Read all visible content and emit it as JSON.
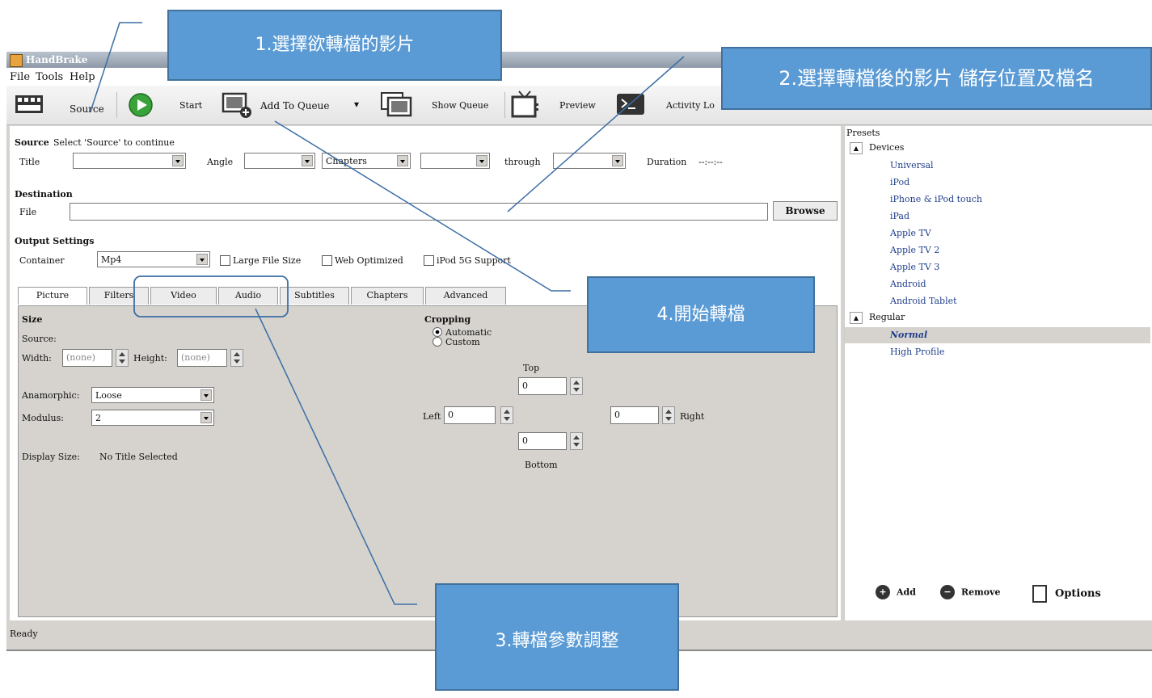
{
  "window": {
    "title": "HandBrake"
  },
  "menu": [
    "File",
    "Tools",
    "Help"
  ],
  "toolbar": {
    "source": "Source",
    "start": "Start",
    "add_to_queue": "Add To Queue",
    "show_queue": "Show Queue",
    "preview": "Preview",
    "activity_log": "Activity Lo"
  },
  "source": {
    "heading": "Source",
    "hint": "Select 'Source' to continue",
    "title_label": "Title",
    "angle_label": "Angle",
    "chapters_value": "Chapters",
    "through_label": "through",
    "duration_label": "Duration",
    "duration_value": "--:--:--"
  },
  "destination": {
    "heading": "Destination",
    "file_label": "File",
    "file_value": "",
    "browse": "Browse"
  },
  "output": {
    "heading": "Output Settings",
    "container_label": "Container",
    "container_value": "Mp4",
    "large_file": "Large File Size",
    "web_optimized": "Web Optimized",
    "ipod_support": "iPod 5G Support"
  },
  "tabs": [
    "Picture",
    "Filters",
    "Video",
    "Audio",
    "Subtitles",
    "Chapters",
    "Advanced"
  ],
  "picture": {
    "size_heading": "Size",
    "source_label": "Source:",
    "width_label": "Width:",
    "width_value": "(none)",
    "height_label": "Height:",
    "height_value": "(none)",
    "anamorphic_label": "Anamorphic:",
    "anamorphic_value": "Loose",
    "modulus_label": "Modulus:",
    "modulus_value": "2",
    "display_size_label": "Display Size:",
    "display_size_value": "No Title Selected",
    "cropping_heading": "Cropping",
    "automatic": "Automatic",
    "custom": "Custom",
    "top": "Top",
    "left": "Left",
    "right": "Right",
    "bottom": "Bottom",
    "crop_top": "0",
    "crop_left": "0",
    "crop_right": "0",
    "crop_bottom": "0"
  },
  "presets": {
    "heading": "Presets",
    "groups": [
      {
        "name": "Devices",
        "items": [
          "Universal",
          "iPod",
          "iPhone & iPod touch",
          "iPad",
          "Apple TV",
          "Apple TV 2",
          "Apple TV 3",
          "Android",
          "Android Tablet"
        ]
      },
      {
        "name": "Regular",
        "items": [
          "Normal",
          "High Profile"
        ]
      }
    ],
    "add": "Add",
    "remove": "Remove",
    "options": "Options"
  },
  "status": "Ready",
  "callouts": {
    "c1": "1.選擇欲轉檔的影片",
    "c2": "2.選擇轉檔後的影片 儲存位置及檔名",
    "c3": "3.轉檔參數調整",
    "c4": "4.開始轉檔"
  },
  "colors": {
    "callout": "#5b9bd5",
    "window": "#d6d3ce",
    "selected_preset": "#d6d3ce"
  }
}
